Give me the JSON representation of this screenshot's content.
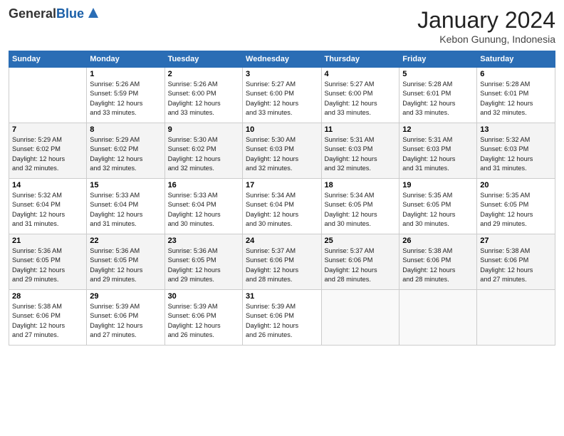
{
  "header": {
    "logo_general": "General",
    "logo_blue": "Blue",
    "month_title": "January 2024",
    "location": "Kebon Gunung, Indonesia"
  },
  "days_of_week": [
    "Sunday",
    "Monday",
    "Tuesday",
    "Wednesday",
    "Thursday",
    "Friday",
    "Saturday"
  ],
  "weeks": [
    {
      "cells": [
        {
          "day": null,
          "info": null
        },
        {
          "day": "1",
          "info": "Sunrise: 5:26 AM\nSunset: 5:59 PM\nDaylight: 12 hours\nand 33 minutes."
        },
        {
          "day": "2",
          "info": "Sunrise: 5:26 AM\nSunset: 6:00 PM\nDaylight: 12 hours\nand 33 minutes."
        },
        {
          "day": "3",
          "info": "Sunrise: 5:27 AM\nSunset: 6:00 PM\nDaylight: 12 hours\nand 33 minutes."
        },
        {
          "day": "4",
          "info": "Sunrise: 5:27 AM\nSunset: 6:00 PM\nDaylight: 12 hours\nand 33 minutes."
        },
        {
          "day": "5",
          "info": "Sunrise: 5:28 AM\nSunset: 6:01 PM\nDaylight: 12 hours\nand 33 minutes."
        },
        {
          "day": "6",
          "info": "Sunrise: 5:28 AM\nSunset: 6:01 PM\nDaylight: 12 hours\nand 32 minutes."
        }
      ]
    },
    {
      "cells": [
        {
          "day": "7",
          "info": "Sunrise: 5:29 AM\nSunset: 6:02 PM\nDaylight: 12 hours\nand 32 minutes."
        },
        {
          "day": "8",
          "info": "Sunrise: 5:29 AM\nSunset: 6:02 PM\nDaylight: 12 hours\nand 32 minutes."
        },
        {
          "day": "9",
          "info": "Sunrise: 5:30 AM\nSunset: 6:02 PM\nDaylight: 12 hours\nand 32 minutes."
        },
        {
          "day": "10",
          "info": "Sunrise: 5:30 AM\nSunset: 6:03 PM\nDaylight: 12 hours\nand 32 minutes."
        },
        {
          "day": "11",
          "info": "Sunrise: 5:31 AM\nSunset: 6:03 PM\nDaylight: 12 hours\nand 32 minutes."
        },
        {
          "day": "12",
          "info": "Sunrise: 5:31 AM\nSunset: 6:03 PM\nDaylight: 12 hours\nand 31 minutes."
        },
        {
          "day": "13",
          "info": "Sunrise: 5:32 AM\nSunset: 6:03 PM\nDaylight: 12 hours\nand 31 minutes."
        }
      ]
    },
    {
      "cells": [
        {
          "day": "14",
          "info": "Sunrise: 5:32 AM\nSunset: 6:04 PM\nDaylight: 12 hours\nand 31 minutes."
        },
        {
          "day": "15",
          "info": "Sunrise: 5:33 AM\nSunset: 6:04 PM\nDaylight: 12 hours\nand 31 minutes."
        },
        {
          "day": "16",
          "info": "Sunrise: 5:33 AM\nSunset: 6:04 PM\nDaylight: 12 hours\nand 30 minutes."
        },
        {
          "day": "17",
          "info": "Sunrise: 5:34 AM\nSunset: 6:04 PM\nDaylight: 12 hours\nand 30 minutes."
        },
        {
          "day": "18",
          "info": "Sunrise: 5:34 AM\nSunset: 6:05 PM\nDaylight: 12 hours\nand 30 minutes."
        },
        {
          "day": "19",
          "info": "Sunrise: 5:35 AM\nSunset: 6:05 PM\nDaylight: 12 hours\nand 30 minutes."
        },
        {
          "day": "20",
          "info": "Sunrise: 5:35 AM\nSunset: 6:05 PM\nDaylight: 12 hours\nand 29 minutes."
        }
      ]
    },
    {
      "cells": [
        {
          "day": "21",
          "info": "Sunrise: 5:36 AM\nSunset: 6:05 PM\nDaylight: 12 hours\nand 29 minutes."
        },
        {
          "day": "22",
          "info": "Sunrise: 5:36 AM\nSunset: 6:05 PM\nDaylight: 12 hours\nand 29 minutes."
        },
        {
          "day": "23",
          "info": "Sunrise: 5:36 AM\nSunset: 6:05 PM\nDaylight: 12 hours\nand 29 minutes."
        },
        {
          "day": "24",
          "info": "Sunrise: 5:37 AM\nSunset: 6:06 PM\nDaylight: 12 hours\nand 28 minutes."
        },
        {
          "day": "25",
          "info": "Sunrise: 5:37 AM\nSunset: 6:06 PM\nDaylight: 12 hours\nand 28 minutes."
        },
        {
          "day": "26",
          "info": "Sunrise: 5:38 AM\nSunset: 6:06 PM\nDaylight: 12 hours\nand 28 minutes."
        },
        {
          "day": "27",
          "info": "Sunrise: 5:38 AM\nSunset: 6:06 PM\nDaylight: 12 hours\nand 27 minutes."
        }
      ]
    },
    {
      "cells": [
        {
          "day": "28",
          "info": "Sunrise: 5:38 AM\nSunset: 6:06 PM\nDaylight: 12 hours\nand 27 minutes."
        },
        {
          "day": "29",
          "info": "Sunrise: 5:39 AM\nSunset: 6:06 PM\nDaylight: 12 hours\nand 27 minutes."
        },
        {
          "day": "30",
          "info": "Sunrise: 5:39 AM\nSunset: 6:06 PM\nDaylight: 12 hours\nand 26 minutes."
        },
        {
          "day": "31",
          "info": "Sunrise: 5:39 AM\nSunset: 6:06 PM\nDaylight: 12 hours\nand 26 minutes."
        },
        {
          "day": null,
          "info": null
        },
        {
          "day": null,
          "info": null
        },
        {
          "day": null,
          "info": null
        }
      ]
    }
  ]
}
